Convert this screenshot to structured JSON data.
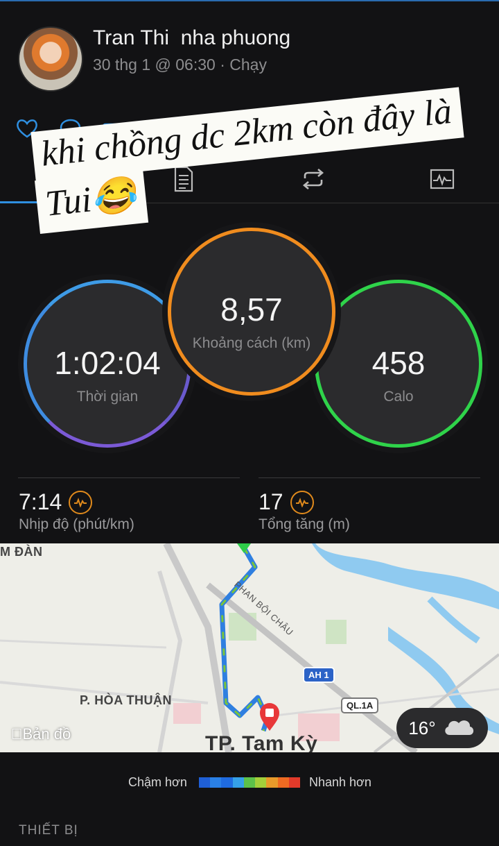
{
  "post": {
    "user_name": "Tran Thi  nha phuong",
    "meta": "30 thg 1 @ 06:30 · Chạy"
  },
  "actions": [
    "heart-icon",
    "comment-icon",
    "add-photo-icon",
    "share-icon"
  ],
  "tabs": [
    {
      "icon": "stats-icon",
      "active": true
    },
    {
      "icon": "details-icon",
      "active": false
    },
    {
      "icon": "laps-icon",
      "active": false
    },
    {
      "icon": "chart-icon",
      "active": false
    }
  ],
  "caption": {
    "line1": "khi chồng dc 2km còn đây là",
    "line2": "Tui😂"
  },
  "stats": {
    "time": {
      "value": "1:02:04",
      "label": "Thời gian",
      "color": "#3e9be6"
    },
    "distance": {
      "value": "8,57",
      "label": "Khoảng cách (km)",
      "color": "#f08c1e"
    },
    "calories": {
      "value": "458",
      "label": "Calo",
      "color": "#2fd34a"
    }
  },
  "metrics": {
    "pace": {
      "value": "7:14",
      "label": "Nhịp độ (phút/km)"
    },
    "elevation": {
      "value": "17",
      "label": "Tổng tăng (m)"
    }
  },
  "map": {
    "corner_label": "M ĐÀN",
    "district": "P. HÒA THUẬN",
    "street": "PHAN BỘI CHÂU",
    "city": "TP. Tam Kỳ",
    "road_ah": "AH 1",
    "road_ql": "QL.1A",
    "attribution": "Bản đồ",
    "weather": "16°"
  },
  "legend": {
    "slower": "Chậm hơn",
    "faster": "Nhanh hơn",
    "colors": [
      "#1f5fd6",
      "#2a80e6",
      "#1f6be0",
      "#35a0e8",
      "#5cc14a",
      "#a3cf3a",
      "#e89a2a",
      "#ee6a22",
      "#e23a2a"
    ]
  },
  "section": {
    "devices": "THIẾT BỊ"
  }
}
